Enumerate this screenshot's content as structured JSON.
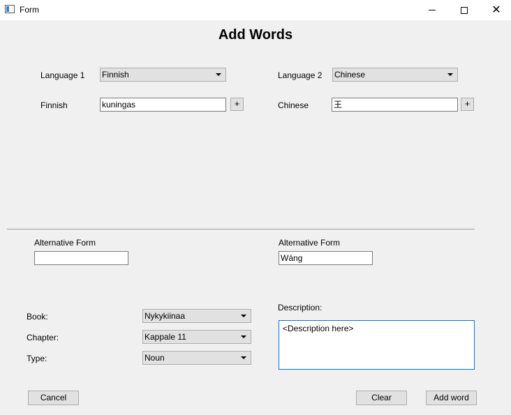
{
  "window": {
    "title": "Form",
    "controls": {
      "minimize": "minimize-icon",
      "maximize": "maximize-icon",
      "close": "close-icon"
    }
  },
  "heading": "Add Words",
  "language1": {
    "label": "Language 1",
    "selected": "Finnish",
    "word_label": "Finnish",
    "word_value": "kuningas",
    "add_label": "+"
  },
  "language2": {
    "label": "Language 2",
    "selected": "Chinese",
    "word_label": "Chinese",
    "word_value": "王",
    "add_label": "+"
  },
  "alt1": {
    "label": "Alternative Form",
    "value": ""
  },
  "alt2": {
    "label": "Alternative Form",
    "value": "Wáng"
  },
  "book": {
    "label": "Book:",
    "selected": "Nykykiinaa"
  },
  "chapter": {
    "label": "Chapter:",
    "selected": "Kappale 11"
  },
  "type": {
    "label": "Type:",
    "selected": "Noun"
  },
  "description": {
    "label": "Description:",
    "value": "<Description here>"
  },
  "buttons": {
    "cancel": "Cancel",
    "clear": "Clear",
    "add_word": "Add word"
  },
  "colors": {
    "focus_border": "#0078d7",
    "background": "#f0f0f0"
  }
}
